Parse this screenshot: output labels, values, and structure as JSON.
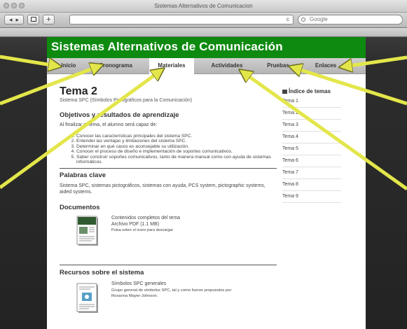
{
  "window": {
    "title": "Sistemas Alternativos de Comunicacion"
  },
  "toolbar": {
    "search_placeholder": "Google",
    "reload_glyph": "c"
  },
  "site": {
    "title": "Sistemas Alternativos de Comunicación"
  },
  "nav": {
    "tabs": [
      {
        "label": "Inicio"
      },
      {
        "label": "Cronograma"
      },
      {
        "label": "Materiales"
      },
      {
        "label": "Actividades"
      },
      {
        "label": "Pruebas"
      },
      {
        "label": "Enlaces"
      }
    ],
    "active_index": 2
  },
  "main": {
    "heading": "Tema 2",
    "subtitle": "Sistema SPC (Símbolos Pictográficos para la Comunicación)",
    "objectives": {
      "title": "Objetivos y resultados de aprendizaje",
      "intro": "Al finalizar el tema, el alumno será capaz de:",
      "items": [
        "Conocer las características principales del sistema SPC.",
        "Entender las ventajas y limitaciones del sistema SPC.",
        "Determinar en qué casos es aconsejable su utilización.",
        "Conocer el proceso de diseño e implementación de soportes comunicativos.",
        "Saber construir soportes comunicativos, tanto de manera manual como con ayuda de sistemas informáticos."
      ]
    },
    "keywords": {
      "title": "Palabras clave",
      "text": "Sistema SPC, sistemas pictográficos, sistemas con ayuda, PCS system, pictographic systems, aided systems."
    },
    "documents": {
      "title": "Documentos",
      "item": {
        "title": "Contenidos completos del tema",
        "meta": "Archivo PDF (1.1 MB)",
        "hint": "Pulsa sobre el icono para descargar"
      }
    },
    "resources": {
      "title": "Recursos sobre el sistema",
      "item": {
        "title": "Símbolos SPC generales",
        "desc_line1": "Grupo general de símbolos SPC, tal y como fueron propuestos por",
        "desc_line2": "Roxanna Mayer-Johnson."
      }
    }
  },
  "sidebar": {
    "title": "Índice de temas",
    "items": [
      "Tema 1",
      "Tema 2",
      "Tema 3",
      "Tema 4",
      "Tema 5",
      "Tema 6",
      "Tema 7",
      "Tema 8",
      "Tema 9"
    ]
  },
  "colors": {
    "header_green": "#0e8a10",
    "arrow_yellow": "#e3e64a",
    "nav_bg": "#c4c4c4",
    "backdrop": "#2d2d2d"
  }
}
